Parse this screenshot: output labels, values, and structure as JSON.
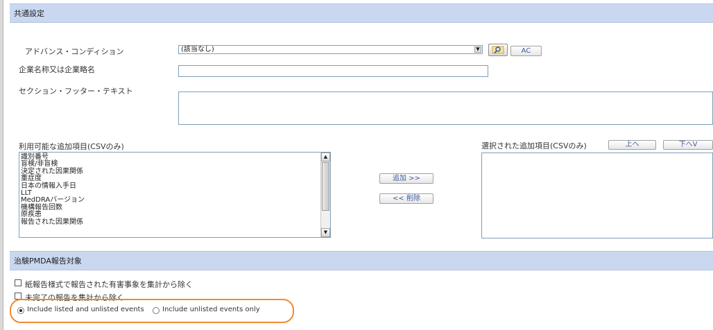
{
  "common_section": {
    "title": "共通設定"
  },
  "advanced_condition": {
    "label": "アドバンス・コンディション",
    "selected": "(該当なし)",
    "ac_button": "AC"
  },
  "company_name": {
    "label": "企業名称又は企業略名",
    "value": ""
  },
  "section_footer": {
    "label": "セクション・フッター・テキスト",
    "value": ""
  },
  "available_items": {
    "label": "利用可能な追加項目(CSVのみ)",
    "items": [
      "識別番号",
      "盲検/非盲検",
      "決定された因果関係",
      "重症度",
      "日本の情報入手日",
      "LLT",
      "MedDRAバージョン",
      "機構報告回数",
      "原疾患",
      "報告された因果関係"
    ]
  },
  "transfer": {
    "add": "追加 >>",
    "remove": "<< 削除"
  },
  "selected_items": {
    "label": "選択された追加項目(CSVのみ)",
    "up": "上へ",
    "down": "下へV",
    "items": []
  },
  "pmda_section": {
    "title": "治験PMDA報告対象"
  },
  "options": {
    "exclude_paper": "紙報告様式で報告された有害事象を集計から除く",
    "exclude_incomplete": "未完了の報告を集計から除く",
    "radio_listed_unlisted": "Include listed and unlisted events",
    "radio_unlisted_only": "Include unlisted events only",
    "selected_radio": "listed_unlisted"
  },
  "colors": {
    "header_bg": "#c9d8f0",
    "highlight": "#f08a2e"
  }
}
